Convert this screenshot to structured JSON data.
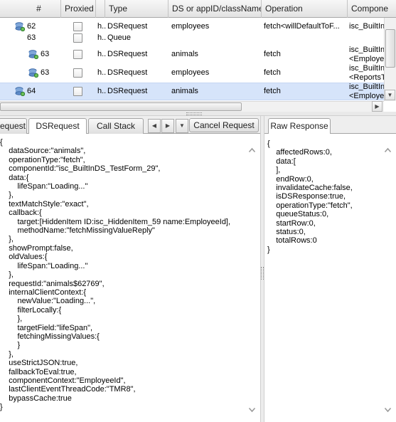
{
  "grid": {
    "columns": [
      "#",
      "Proxied",
      "Type",
      "DS or appID/className",
      "Operation",
      "Compone"
    ],
    "rows": [
      {
        "num": "62",
        "h": "h..",
        "type": "DSRequest",
        "ds": "employees",
        "op": "fetch<willDefaultToF...",
        "comp": "isc_BuiltIn",
        "comp2": "",
        "icon": true,
        "indent": 1,
        "selected": false
      },
      {
        "num": "63",
        "h": "h..",
        "type": "Queue",
        "ds": "",
        "op": "",
        "comp": "",
        "comp2": "",
        "icon": false,
        "indent": 1,
        "selected": false
      },
      {
        "num": "63",
        "h": "h..",
        "type": "DSRequest",
        "ds": "animals",
        "op": "fetch",
        "comp": "isc_BuiltIn",
        "comp2": "<Employe",
        "icon": true,
        "indent": 2,
        "selected": false
      },
      {
        "num": "63",
        "h": "h..",
        "type": "DSRequest",
        "ds": "employees",
        "op": "fetch",
        "comp": "isc_BuiltIn",
        "comp2": "<ReportsT",
        "icon": true,
        "indent": 2,
        "selected": false
      },
      {
        "num": "64",
        "h": "h..",
        "type": "DSRequest",
        "ds": "animals",
        "op": "fetch",
        "comp": "isc_BuiltIn",
        "comp2": "<Employe",
        "icon": true,
        "indent": 1,
        "selected": true
      }
    ]
  },
  "left_tabs": {
    "tabs": [
      "equest",
      "DSRequest",
      "Call Stack"
    ],
    "active": "DSRequest",
    "cancel_label": "Cancel Request"
  },
  "right_tabs": {
    "tabs": [
      "Raw Response"
    ]
  },
  "request_lines": [
    "{",
    "    dataSource:\"animals\",",
    "    operationType:\"fetch\",",
    "    componentId:\"isc_BuiltInDS_TestForm_29\",",
    "    data:{",
    "        lifeSpan:\"Loading...\"",
    "    },",
    "    textMatchStyle:\"exact\",",
    "    callback:{",
    "        target:[HiddenItem ID:isc_HiddenItem_59 name:EmployeeId],",
    "        methodName:\"fetchMissingValueReply\"",
    "    },",
    "    showPrompt:false,",
    "    oldValues:{",
    "        lifeSpan:\"Loading...\"",
    "    },",
    "    requestId:\"animals$62769\",",
    "    internalClientContext:{",
    "        newValue:\"Loading...\",",
    "        filterLocally:{",
    "        },",
    "        targetField:\"lifeSpan\",",
    "        fetchingMissingValues:{",
    "        }",
    "    },",
    "    useStrictJSON:true,",
    "    fallbackToEval:true,",
    "    componentContext:\"EmployeeId\",",
    "    lastClientEventThreadCode:\"TMR8\",",
    "    bypassCache:true",
    "}"
  ],
  "response_lines": [
    "{",
    "    affectedRows:0,",
    "    data:[",
    "    ],",
    "    endRow:0,",
    "    invalidateCache:false,",
    "    isDSResponse:true,",
    "    operationType:\"fetch\",",
    "    queueStatus:0,",
    "    startRow:0,",
    "    status:0,",
    "    totalRows:0",
    "}"
  ],
  "colors": {
    "selected_row": "#d6e4fa",
    "header_bg": "#e6e6e6",
    "border": "#a4a4a4"
  },
  "icons": [
    "datasource-icon",
    "checkbox",
    "chevron-up-icon",
    "chevron-down-icon",
    "chevron-left-icon",
    "chevron-right-icon",
    "dropdown-icon"
  ]
}
